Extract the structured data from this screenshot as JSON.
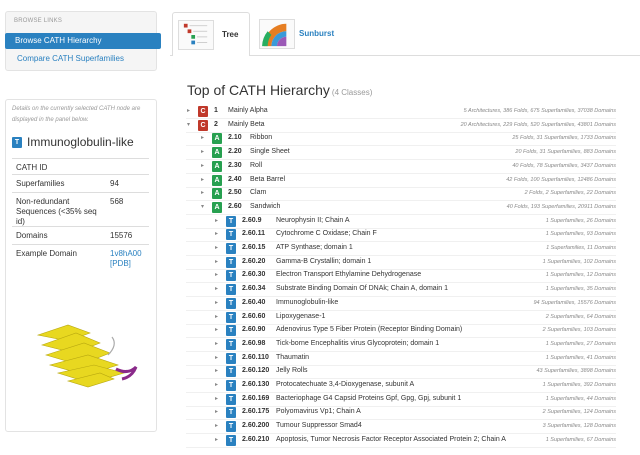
{
  "sidebar": {
    "browse_heading": "BROWSE LINKS",
    "active_nav": "Browse CATH Hierarchy",
    "nav_link": "Compare CATH Superfamilies",
    "detail_note": "Details on the currently selected CATH node are displayed in the panel below.",
    "detail_badge": "T",
    "detail_title": "Immunoglobulin-like",
    "fields": [
      {
        "key": "CATH ID",
        "value": ""
      },
      {
        "key": "Superfamilies",
        "value": "94"
      },
      {
        "key": "Non-redundant Sequences (<35% seq id)",
        "value": "568"
      },
      {
        "key": "Domains",
        "value": "15576"
      },
      {
        "key": "Example Domain",
        "value": "1v8hA00 [PDB]"
      }
    ]
  },
  "tabs": [
    {
      "label": "Tree",
      "active": true
    },
    {
      "label": "Sunburst",
      "active": false
    }
  ],
  "title": "Top of CATH Hierarchy",
  "title_count": "(4 Classes)",
  "colors": {
    "class": "#c0392b",
    "architecture": "#27a050",
    "topology": "#2a81c0"
  },
  "tree": [
    {
      "tog": "▸",
      "badge": "C",
      "level": "class",
      "num": "1",
      "name": "Mainly Alpha",
      "meta": "5 Architectures, 386 Folds, 675 Superfamilies, 37038 Domains"
    },
    {
      "tog": "▾",
      "badge": "C",
      "level": "class",
      "num": "2",
      "name": "Mainly Beta",
      "meta": "20 Architectures, 229 Folds, 520 Superfamilies, 43801 Domains"
    },
    {
      "tog": "▸",
      "badge": "A",
      "level": "architecture",
      "num": "2.10",
      "name": "Ribbon",
      "meta": "25 Folds, 31 Superfamilies, 1733 Domains"
    },
    {
      "tog": "▸",
      "badge": "A",
      "level": "architecture",
      "num": "2.20",
      "name": "Single Sheet",
      "meta": "20 Folds, 31 Superfamilies, 883 Domains"
    },
    {
      "tog": "▸",
      "badge": "A",
      "level": "architecture",
      "num": "2.30",
      "name": "Roll",
      "meta": "40 Folds, 78 Superfamilies, 3437 Domains"
    },
    {
      "tog": "▸",
      "badge": "A",
      "level": "architecture",
      "num": "2.40",
      "name": "Beta Barrel",
      "meta": "42 Folds, 100 Superfamilies, 12486 Domains"
    },
    {
      "tog": "▸",
      "badge": "A",
      "level": "architecture",
      "num": "2.50",
      "name": "Clam",
      "meta": "2 Folds, 2 Superfamilies, 22 Domains"
    },
    {
      "tog": "▾",
      "badge": "A",
      "level": "architecture",
      "num": "2.60",
      "name": "Sandwich",
      "meta": "40 Folds, 193 Superfamilies, 20911 Domains"
    },
    {
      "tog": "▸",
      "badge": "T",
      "level": "topology",
      "num": "2.60.9",
      "name": "Neurophysin II; Chain A",
      "meta": "1 Superfamilies, 26 Domains"
    },
    {
      "tog": "▸",
      "badge": "T",
      "level": "topology",
      "num": "2.60.11",
      "name": "Cytochrome C Oxidase; Chain F",
      "meta": "1 Superfamilies, 93 Domains"
    },
    {
      "tog": "▸",
      "badge": "T",
      "level": "topology",
      "num": "2.60.15",
      "name": "ATP Synthase; domain 1",
      "meta": "1 Superfamilies, 11 Domains"
    },
    {
      "tog": "▸",
      "badge": "T",
      "level": "topology",
      "num": "2.60.20",
      "name": "Gamma-B Crystallin; domain 1",
      "meta": "1 Superfamilies, 102 Domains"
    },
    {
      "tog": "▸",
      "badge": "T",
      "level": "topology",
      "num": "2.60.30",
      "name": "Electron Transport Ethylamine Dehydrogenase",
      "meta": "1 Superfamilies, 12 Domains"
    },
    {
      "tog": "▸",
      "badge": "T",
      "level": "topology",
      "num": "2.60.34",
      "name": "Substrate Binding Domain Of DNAk; Chain A, domain 1",
      "meta": "1 Superfamilies, 35 Domains"
    },
    {
      "tog": "▸",
      "badge": "T",
      "level": "topology",
      "num": "2.60.40",
      "name": "Immunoglobulin-like",
      "meta": "94 Superfamilies, 15576 Domains"
    },
    {
      "tog": "▸",
      "badge": "T",
      "level": "topology",
      "num": "2.60.60",
      "name": "Lipoxygenase-1",
      "meta": "2 Superfamilies, 64 Domains"
    },
    {
      "tog": "▸",
      "badge": "T",
      "level": "topology",
      "num": "2.60.90",
      "name": "Adenovirus Type 5 Fiber Protein (Receptor Binding Domain)",
      "meta": "2 Superfamilies, 103 Domains"
    },
    {
      "tog": "▸",
      "badge": "T",
      "level": "topology",
      "num": "2.60.98",
      "name": "Tick-borne Encephalitis virus Glycoprotein; domain 1",
      "meta": "1 Superfamilies, 27 Domains"
    },
    {
      "tog": "▸",
      "badge": "T",
      "level": "topology",
      "num": "2.60.110",
      "name": "Thaumatin",
      "meta": "1 Superfamilies, 41 Domains"
    },
    {
      "tog": "▸",
      "badge": "T",
      "level": "topology",
      "num": "2.60.120",
      "name": "Jelly Rolls",
      "meta": "43 Superfamilies, 3898 Domains"
    },
    {
      "tog": "▸",
      "badge": "T",
      "level": "topology",
      "num": "2.60.130",
      "name": "Protocatechuate 3,4-Dioxygenase, subunit A",
      "meta": "1 Superfamilies, 392 Domains"
    },
    {
      "tog": "▸",
      "badge": "T",
      "level": "topology",
      "num": "2.60.169",
      "name": "Bacteriophage G4 Capsid Proteins Gpf, Gpg, Gpj, subunit 1",
      "meta": "1 Superfamilies, 44 Domains"
    },
    {
      "tog": "▸",
      "badge": "T",
      "level": "topology",
      "num": "2.60.175",
      "name": "Polyomavirus Vp1; Chain A",
      "meta": "2 Superfamilies, 124 Domains"
    },
    {
      "tog": "▸",
      "badge": "T",
      "level": "topology",
      "num": "2.60.200",
      "name": "Tumour Suppressor Smad4",
      "meta": "3 Superfamilies, 128 Domains"
    },
    {
      "tog": "▸",
      "badge": "T",
      "level": "topology",
      "num": "2.60.210",
      "name": "Apoptosis, Tumor Necrosis Factor Receptor Associated Protein 2; Chain A",
      "meta": "1 Superfamilies, 67 Domains"
    }
  ]
}
